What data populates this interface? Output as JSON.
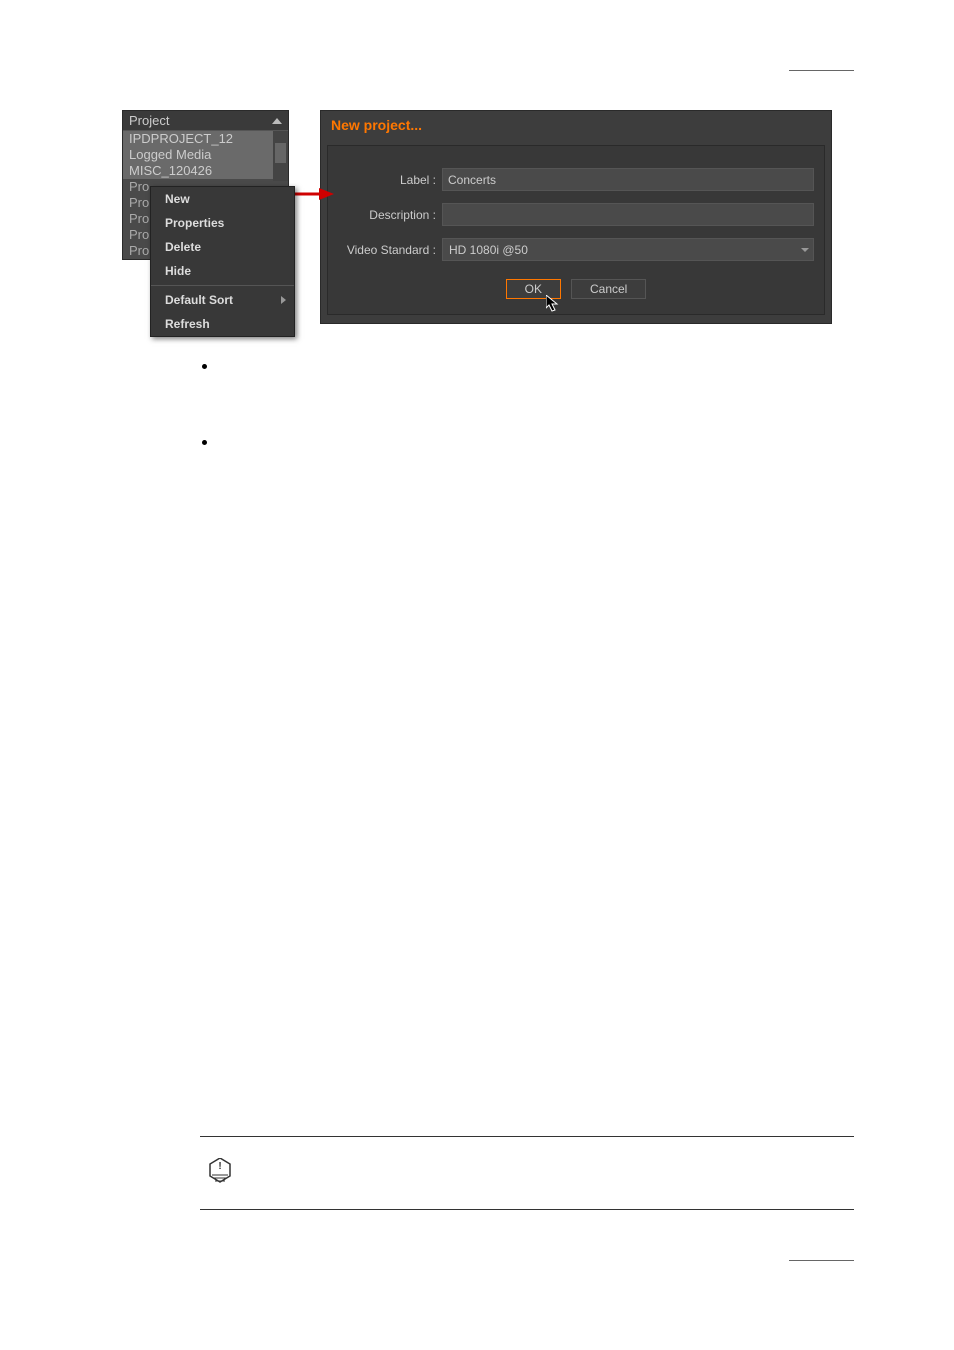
{
  "project_panel": {
    "header": "Project",
    "visible_items": [
      "IPDPROJECT_12",
      "Logged Media",
      "MISC_120426"
    ],
    "partial_items": [
      "Pro",
      "Pro",
      "Pro",
      "Pro",
      "Pro"
    ]
  },
  "context_menu": {
    "items": [
      "New",
      "Properties",
      "Delete",
      "Hide",
      "Default Sort",
      "Refresh"
    ]
  },
  "dialog": {
    "title": "New project...",
    "label_label": "Label :",
    "label_value": "Concerts",
    "description_label": "Description :",
    "description_value": "",
    "video_standard_label": "Video Standard :",
    "video_standard_value": "HD 1080i @50",
    "ok_button": "OK",
    "cancel_button": "Cancel"
  }
}
